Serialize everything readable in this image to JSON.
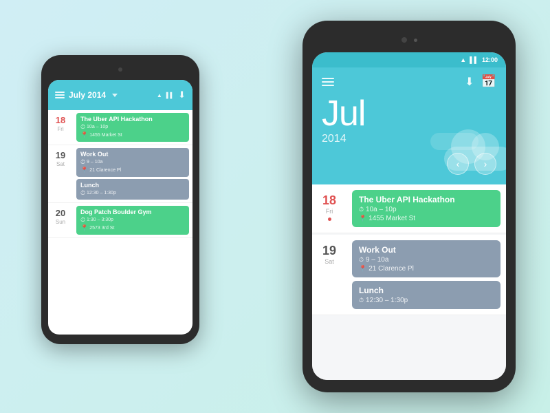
{
  "background": "#c8f0e8",
  "small_phone": {
    "header": {
      "title": "July 2014",
      "dropdown_visible": true
    },
    "days": [
      {
        "num": "18",
        "name": "Fri",
        "num_class": "red",
        "events": [
          {
            "type": "green",
            "title": "The Uber API Hackathon",
            "time": "10a – 10p",
            "location": "1455 Market St"
          }
        ]
      },
      {
        "num": "19",
        "name": "Sat",
        "num_class": "",
        "events": [
          {
            "type": "gray",
            "title": "Work Out",
            "time": "9 – 10a",
            "location": "21 Clarence Pl"
          },
          {
            "type": "gray",
            "title": "Lunch",
            "time": "12:30 – 1:30p",
            "location": ""
          }
        ]
      },
      {
        "num": "20",
        "name": "Sun",
        "num_class": "",
        "events": [
          {
            "type": "green",
            "title": "Dog Patch Boulder Gym",
            "time": "1:30 – 3:30p",
            "location": "2573 3rd St"
          }
        ]
      }
    ]
  },
  "large_phone": {
    "status_bar": {
      "time": "12:00"
    },
    "header": {
      "month": "Jul",
      "year": "2014"
    },
    "days": [
      {
        "num": "18",
        "name": "Fri",
        "num_class": "red",
        "has_dot": true,
        "events": [
          {
            "type": "green",
            "title": "The Uber API Hackathon",
            "time": "10a – 10p",
            "location": "1455 Market St"
          }
        ]
      },
      {
        "num": "19",
        "name": "Sat",
        "num_class": "",
        "has_dot": false,
        "events": [
          {
            "type": "gray",
            "title": "Work Out",
            "time": "9 – 10a",
            "location": "21 Clarence Pl"
          },
          {
            "type": "gray",
            "title": "Lunch",
            "time": "12:30 – 1:30p",
            "location": ""
          }
        ]
      }
    ],
    "nav": {
      "prev": "‹",
      "next": "›"
    },
    "toolbar": {
      "download_label": "⬇",
      "calendar_add_label": "📅"
    }
  }
}
